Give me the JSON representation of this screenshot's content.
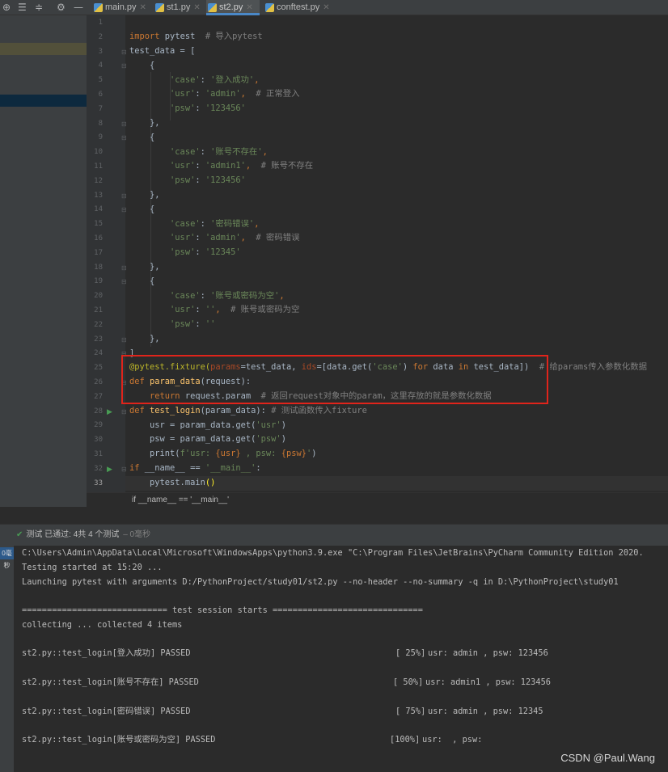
{
  "toolbar": {
    "icons": [
      "target-icon",
      "collapse-all-icon",
      "expand-all-icon",
      "gear-icon",
      "hide-icon"
    ]
  },
  "tabs": [
    {
      "label": "main.py",
      "active": false
    },
    {
      "label": "st1.py",
      "active": false
    },
    {
      "label": "st2.py",
      "active": true
    },
    {
      "label": "conftest.py",
      "active": false
    }
  ],
  "editor": {
    "current_line": 33,
    "breadcrumb": "if __name__ == '__main__'",
    "line_numbers": [
      "1",
      "2",
      "3",
      "4",
      "5",
      "6",
      "7",
      "8",
      "9",
      "10",
      "11",
      "12",
      "13",
      "14",
      "15",
      "16",
      "17",
      "18",
      "19",
      "20",
      "21",
      "22",
      "23",
      "24",
      "25",
      "26",
      "27",
      "28",
      "29",
      "30",
      "31",
      "32",
      "33"
    ],
    "run_markers": [
      28,
      32
    ],
    "code": {
      "l2_kw": "import",
      "l2_mod": " pytest  ",
      "l2_cm": "# 导入pytest",
      "l3": "test_data = [",
      "l4": "    {",
      "l5_key": "'case'",
      "l5_sep": ": ",
      "l5_val": "'登入成功'",
      "l5_end": ",",
      "l6_key": "'usr'",
      "l6_sep": ": ",
      "l6_val": "'admin'",
      "l6_end": ",  ",
      "l6_cm": "# 正常登入",
      "l7_key": "'psw'",
      "l7_sep": ": ",
      "l7_val": "'123456'",
      "l8": "    },",
      "l9": "    {",
      "l10_key": "'case'",
      "l10_sep": ": ",
      "l10_val": "'账号不存在'",
      "l10_end": ",",
      "l11_key": "'usr'",
      "l11_sep": ": ",
      "l11_val": "'admin1'",
      "l11_end": ",  ",
      "l11_cm": "# 账号不存在",
      "l12_key": "'psw'",
      "l12_sep": ": ",
      "l12_val": "'123456'",
      "l13": "    },",
      "l14": "    {",
      "l15_key": "'case'",
      "l15_sep": ": ",
      "l15_val": "'密码错误'",
      "l15_end": ",",
      "l16_key": "'usr'",
      "l16_sep": ": ",
      "l16_val": "'admin'",
      "l16_end": ",  ",
      "l16_cm": "# 密码错误",
      "l17_key": "'psw'",
      "l17_sep": ": ",
      "l17_val": "'12345'",
      "l18": "    },",
      "l19": "    {",
      "l20_key": "'case'",
      "l20_sep": ": ",
      "l20_val": "'账号或密码为空'",
      "l20_end": ",",
      "l21_key": "'usr'",
      "l21_sep": ": ",
      "l21_val": "''",
      "l21_end": ",  ",
      "l21_cm": "# 账号或密码为空",
      "l22_key": "'psw'",
      "l22_sep": ": ",
      "l22_val": "''",
      "l23": "    },",
      "l24": "]",
      "l25_dec": "@pytest.fixture(",
      "l25_p1": "params",
      "l25_a": "=test_data, ",
      "l25_p2": "ids",
      "l25_b": "=[data.get(",
      "l25_s": "'case'",
      "l25_c": ") ",
      "l25_for": "for",
      "l25_d": " data ",
      "l25_in": "in",
      "l25_e": " test_data])  ",
      "l25_cm": "# 给params传入参数化数据",
      "l26_kw": "def",
      "l26_fn": " param_data",
      "l26_rest": "(request):",
      "l27_kw": "    return",
      "l27_rest": " request.param  ",
      "l27_cm": "# 返回request对象中的param，这里存放的就是参数化数据",
      "l28_kw": "def",
      "l28_fn": " test_login",
      "l28_rest": "(param_data): ",
      "l28_cm": "# 测试函数传入fixture",
      "l29_a": "    usr = param_data.get(",
      "l29_s": "'usr'",
      "l29_b": ")",
      "l30_a": "    psw = param_data.get(",
      "l30_s": "'psw'",
      "l30_b": ")",
      "l31_a": "    print(",
      "l31_s1": "f'usr: ",
      "l31_v1": "{usr}",
      "l31_s2": " , psw: ",
      "l31_v2": "{psw}",
      "l31_s3": "'",
      "l31_b": ")",
      "l32_kw": "if",
      "l32_a": " __name__ == ",
      "l32_s": "'__main__'",
      "l32_b": ":",
      "l33_a": "    pytest.main",
      "l33_b": "()"
    }
  },
  "run": {
    "status_main": "测试 已通过: 4共 4 个测试",
    "status_sub": "– 0毫秒",
    "side_tag": "0毫秒",
    "console": {
      "cmd": "C:\\Users\\Admin\\AppData\\Local\\Microsoft\\WindowsApps\\python3.9.exe \"C:\\Program Files\\JetBrains\\PyCharm Community Edition 2020.",
      "started": "Testing started at 15:20 ...",
      "launching": "Launching pytest with arguments D:/PythonProject/study01/st2.py --no-header --no-summary -q in D:\\PythonProject\\study01",
      "session": "============================= test session starts ==============================",
      "collecting": "collecting ... collected 4 items",
      "results": [
        {
          "name": "st2.py::test_login[登入成功] PASSED",
          "pct": "[ 25%]",
          "out": "usr: admin , psw: 123456"
        },
        {
          "name": "st2.py::test_login[账号不存在] PASSED",
          "pct": "[ 50%]",
          "out": "usr: admin1 , psw: 123456"
        },
        {
          "name": "st2.py::test_login[密码错误] PASSED",
          "pct": "[ 75%]",
          "out": "usr: admin , psw: 12345"
        },
        {
          "name": "st2.py::test_login[账号或密码为空] PASSED",
          "pct": "[100%]",
          "out": "usr:  , psw:"
        }
      ]
    }
  },
  "watermark": "CSDN @Paul.Wang",
  "colors": {
    "keyword": "#cc7832",
    "string": "#6a8759",
    "comment": "#808080",
    "decorator": "#bbb529",
    "function": "#ffc66d",
    "highlight_box": "#e0241b",
    "pass_green": "#499c54"
  }
}
